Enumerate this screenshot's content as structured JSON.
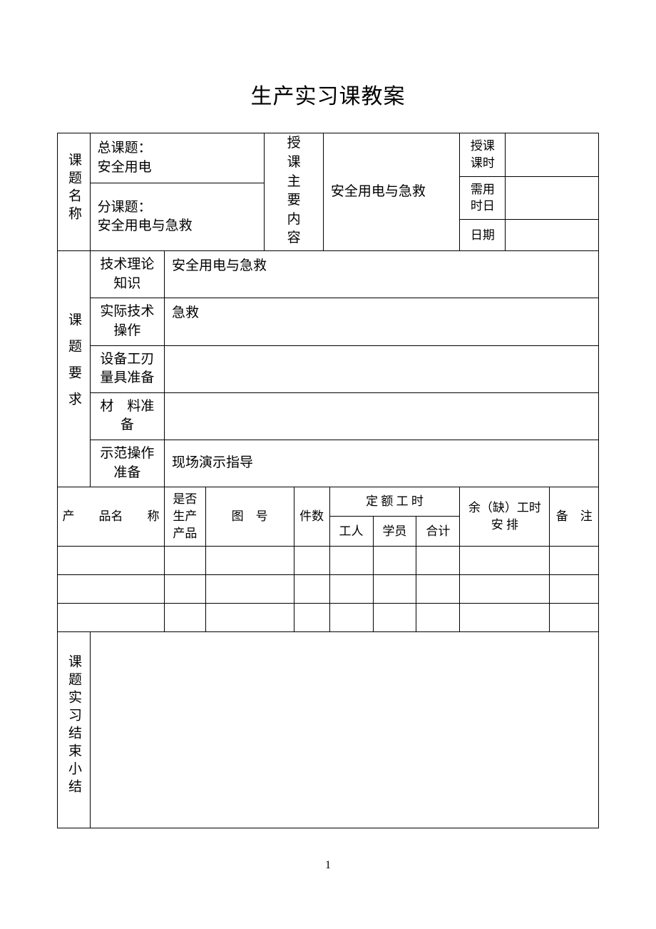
{
  "title": "生产实习课教案",
  "section1": {
    "left_label": "课题名称",
    "main_topic_label": "总课题：",
    "main_topic_value": "安全用电",
    "sub_topic_label": "分课题：",
    "sub_topic_value": "安全用电与急救",
    "teaching_content_label": "授课主要内容",
    "teaching_content_value": "安全用电与急救",
    "hours_label": "授课课时",
    "hours_value": "",
    "days_label": "需用时日",
    "days_value": "",
    "date_label": "日期",
    "date_value": ""
  },
  "section2": {
    "left_label": "课题要求",
    "rows": [
      {
        "label": "技术理论知识",
        "value": "安全用电与急救"
      },
      {
        "label": "实际技术操作",
        "value": "急救"
      },
      {
        "label": "设备工刃量具准备",
        "value": ""
      },
      {
        "label": "材　料准　备",
        "value": ""
      },
      {
        "label": "示范操作准备",
        "value": "现场演示指导"
      }
    ]
  },
  "section3": {
    "headers": {
      "product_name": "产　　品名　　称",
      "is_prod": "是否生产产品",
      "drawing_no": "图　号",
      "qty": "件数",
      "quota_hours": "定 额 工 时",
      "worker": "工人",
      "trainee": "学员",
      "total": "合计",
      "surplus": "余（缺）工时　安 排",
      "remark": "备　注"
    }
  },
  "section4": {
    "left_label": "课题实习结束小结",
    "content": ""
  },
  "page_number": "1"
}
